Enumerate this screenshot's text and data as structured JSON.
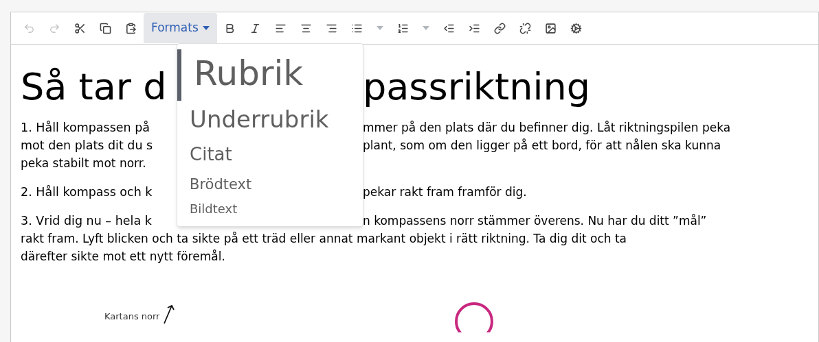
{
  "toolbar": [
    {
      "kind": "icon",
      "disabled": true
    },
    {
      "kind": "icon",
      "disabled": true
    },
    {
      "kind": "icon",
      "disabled": false
    },
    {
      "kind": "icon",
      "disabled": false
    },
    {
      "kind": "icon",
      "disabled": false
    },
    {
      "kind": "dropdown",
      "label": "Formats",
      "expanded": true
    },
    {
      "kind": "icon",
      "disabled": false
    },
    {
      "kind": "icon",
      "disabled": false
    },
    {
      "kind": "icon",
      "disabled": false
    },
    {
      "kind": "icon",
      "disabled": false
    },
    {
      "kind": "icon",
      "disabled": false
    },
    {
      "kind": "split",
      "disabled": false
    },
    {
      "kind": "split",
      "disabled": false
    },
    {
      "kind": "icon",
      "disabled": false
    },
    {
      "kind": "icon",
      "disabled": false
    },
    {
      "kind": "icon",
      "disabled": false
    },
    {
      "kind": "icon",
      "disabled": false
    },
    {
      "kind": "icon",
      "disabled": false
    },
    {
      "kind": "icon",
      "disabled": false
    }
  ],
  "formats_menu": [
    {
      "label": "Rubrik",
      "kind": "heading1",
      "selected": true
    },
    {
      "label": "Underrubrik",
      "kind": "heading2",
      "selected": false
    },
    {
      "label": "Citat",
      "kind": "quote",
      "selected": false
    },
    {
      "label": "Brödtext",
      "kind": "body",
      "selected": false
    },
    {
      "label": "Bildtext",
      "kind": "caption",
      "selected": false
    }
  ],
  "document": {
    "heading": {
      "left": "Så tar d",
      "right": "passriktning"
    },
    "paragraphs": [
      [
        {
          "left": "1. Håll kompassen på",
          "right": "mmer på den plats där du befinner dig. Låt riktningspilen peka"
        },
        {
          "left": "mot den plats dit du s",
          "right": "plant, som om den ligger på ett bord, för att nålen ska kunna"
        },
        {
          "left": "peka stabilt mot norr."
        }
      ],
      [
        {
          "left": "2. Håll kompass och k",
          "right": "pekar rakt fram framför dig."
        }
      ],
      [
        {
          "left": "3. Vrid dig nu – hela k",
          "right": "n kompassens norr stämmer överens. Nu har du ditt ”mål”"
        },
        {
          "left": "rakt fram. Lyft blicken och ta sikte på ett träd eller annat markant objekt i rätt riktning. Ta dig dit och ta"
        },
        {
          "left": "därefter sikte mot ett nytt föremål."
        }
      ]
    ],
    "figure_label": "Kartans norr"
  }
}
